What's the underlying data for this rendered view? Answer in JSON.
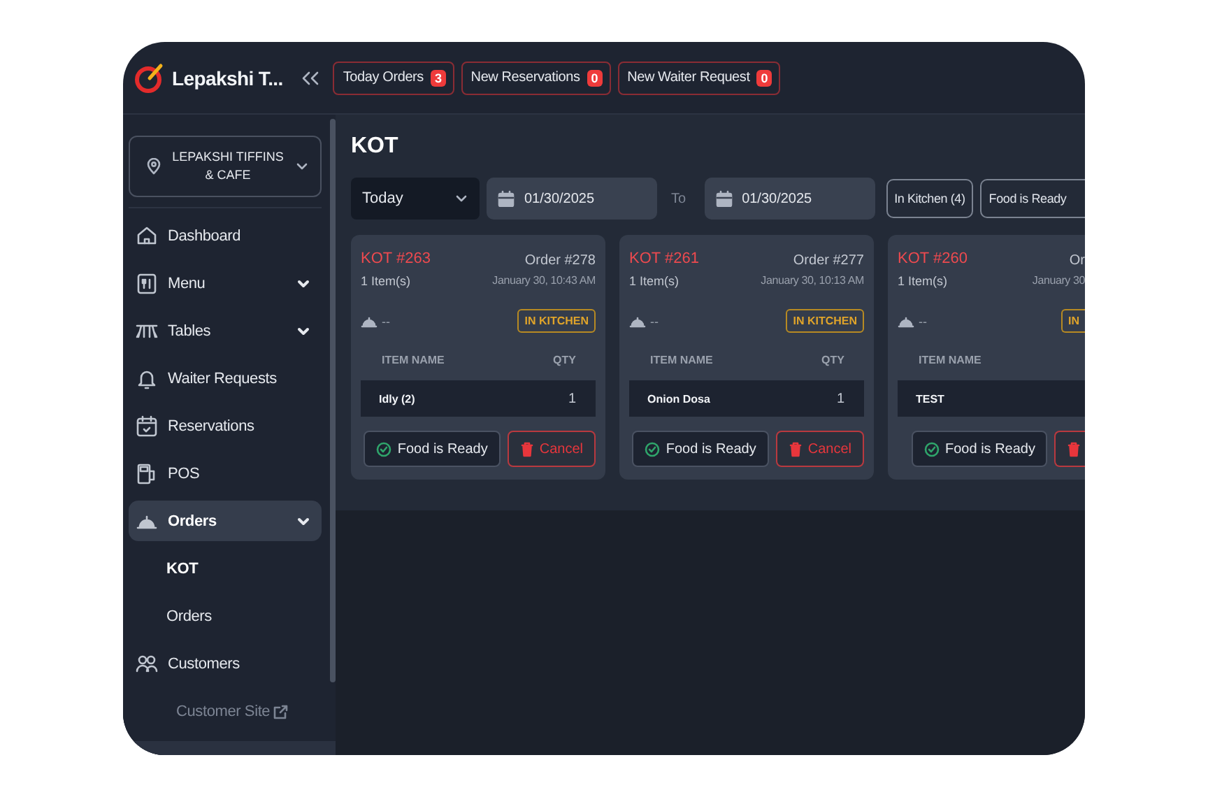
{
  "brand": {
    "name": "Lepakshi T..."
  },
  "header_buttons": [
    {
      "label": "Today Orders",
      "count": "3"
    },
    {
      "label": "New Reservations",
      "count": "0"
    },
    {
      "label": "New Waiter Request",
      "count": "0"
    }
  ],
  "location": {
    "label": "LEPAKSHI TIFFINS & CAFE"
  },
  "sidebar": {
    "items": [
      {
        "label": "Dashboard",
        "expandable": false,
        "selected": false
      },
      {
        "label": "Menu",
        "expandable": true,
        "selected": false
      },
      {
        "label": "Tables",
        "expandable": true,
        "selected": false
      },
      {
        "label": "Waiter Requests",
        "expandable": false,
        "selected": false
      },
      {
        "label": "Reservations",
        "expandable": false,
        "selected": false
      },
      {
        "label": "POS",
        "expandable": false,
        "selected": false
      },
      {
        "label": "Orders",
        "expandable": true,
        "selected": true,
        "children": [
          {
            "label": "KOT",
            "selected": true
          },
          {
            "label": "Orders",
            "selected": false
          }
        ]
      },
      {
        "label": "Customers",
        "expandable": false,
        "selected": false
      }
    ],
    "footer_link": "Customer Site"
  },
  "page": {
    "title": "KOT",
    "period": "Today",
    "date_from": "01/30/2025",
    "to_label": "To",
    "date_to": "01/30/2025",
    "status_filters": [
      {
        "label": "In Kitchen (4)"
      },
      {
        "label": "Food is Ready"
      }
    ]
  },
  "cards": [
    {
      "kot": "KOT #263",
      "order": "Order #278",
      "items_count": "1 Item(s)",
      "time": "January 30, 10:43 AM",
      "table": "--",
      "status": "IN KITCHEN",
      "columns": [
        "ITEM NAME",
        "QTY"
      ],
      "items": [
        {
          "name": "Idly (2)",
          "qty": "1"
        }
      ],
      "actions": [
        {
          "kind": "ready",
          "label": "Food is Ready"
        },
        {
          "kind": "cancel",
          "label": "Cancel"
        }
      ]
    },
    {
      "kot": "KOT #261",
      "order": "Order #277",
      "items_count": "1 Item(s)",
      "time": "January 30, 10:13 AM",
      "table": "--",
      "status": "IN KITCHEN",
      "columns": [
        "ITEM NAME",
        "QTY"
      ],
      "items": [
        {
          "name": "Onion Dosa",
          "qty": "1"
        }
      ],
      "actions": [
        {
          "kind": "ready",
          "label": "Food is Ready"
        },
        {
          "kind": "cancel",
          "label": "Cancel"
        }
      ]
    },
    {
      "kot": "KOT #260",
      "order": "Or",
      "items_count": "1 Item(s)",
      "time": "January 30",
      "table": "--",
      "status": "IN",
      "columns": [
        "ITEM NAME"
      ],
      "items": [
        {
          "name": "TEST"
        }
      ],
      "actions": [
        {
          "kind": "ready",
          "label": "Food is Ready"
        },
        {
          "kind": "cancel"
        }
      ]
    }
  ]
}
